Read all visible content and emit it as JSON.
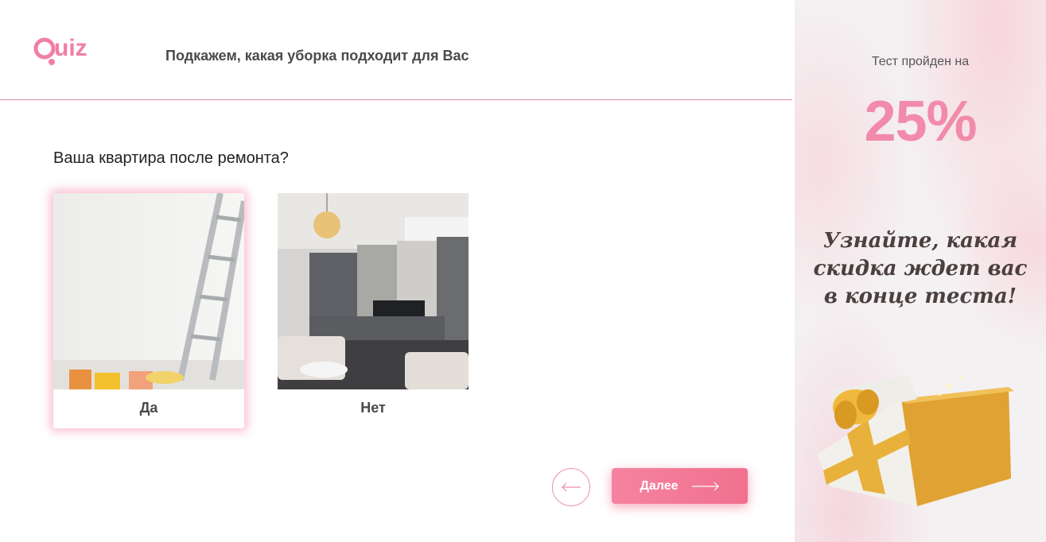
{
  "header": {
    "logo_text": "Quiz",
    "title": "Подкажем, какая уборка подходит для Вас"
  },
  "question": "Ваша квартира после ремонта?",
  "options": [
    {
      "label": "Да",
      "selected": true
    },
    {
      "label": "Нет",
      "selected": false
    }
  ],
  "navigation": {
    "back_icon": "arrow-left-icon",
    "next_label": "Далее",
    "next_icon": "arrow-right-icon"
  },
  "sidebar": {
    "caption": "Тест пройден на",
    "progress": "25%",
    "progress_value": 25,
    "promo_lines": [
      "Узнайте, какая",
      "скидка ждет вас",
      "в конце теста!"
    ]
  },
  "colors": {
    "accent": "#f28aac",
    "button": "#f0718f",
    "divider": "#e08aa3"
  }
}
